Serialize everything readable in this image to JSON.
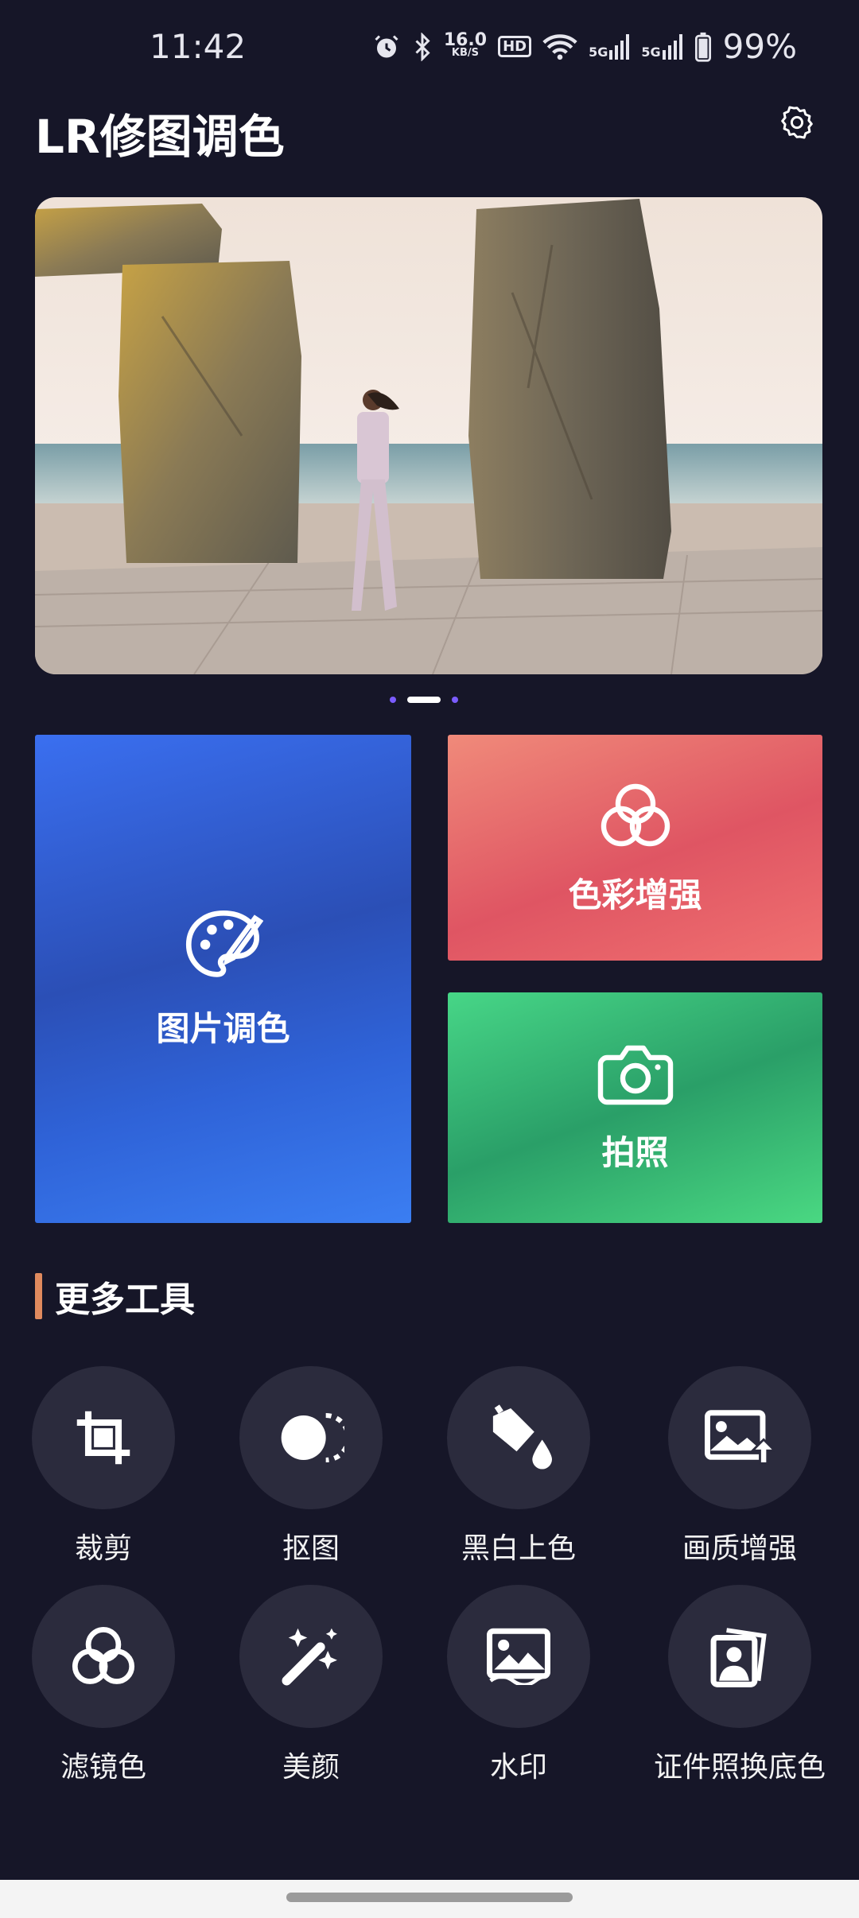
{
  "status": {
    "time": "11:42",
    "speed_top": "16.0",
    "speed_unit": "KB/S",
    "hd": "HD",
    "net1": "5G",
    "net2": "5G",
    "battery": "99%"
  },
  "header": {
    "title": "LR修图调色"
  },
  "carousel": {
    "pages": 3,
    "active": 1
  },
  "cards": {
    "photo_color": "图片调色",
    "color_enhance": "色彩增强",
    "camera": "拍照"
  },
  "section": {
    "title": "更多工具"
  },
  "tools": [
    {
      "label": "裁剪",
      "icon": "crop-icon"
    },
    {
      "label": "抠图",
      "icon": "cutout-icon"
    },
    {
      "label": "黑白上色",
      "icon": "paint-bucket-icon"
    },
    {
      "label": "画质增强",
      "icon": "image-upscale-icon"
    },
    {
      "label": "滤镜色",
      "icon": "filter-circles-icon"
    },
    {
      "label": "美颜",
      "icon": "magic-wand-icon"
    },
    {
      "label": "水印",
      "icon": "watermark-image-icon"
    },
    {
      "label": "证件照换底色",
      "icon": "id-photo-icon"
    }
  ],
  "colors": {
    "background": "#161628",
    "blue_card": "#2f5fd0",
    "red_card": "#e35b64",
    "green_card": "#3cc67a",
    "accent_bar": "#e08a5e",
    "dot_active": "#ffffff",
    "dot_inactive": "#7b5cff"
  }
}
